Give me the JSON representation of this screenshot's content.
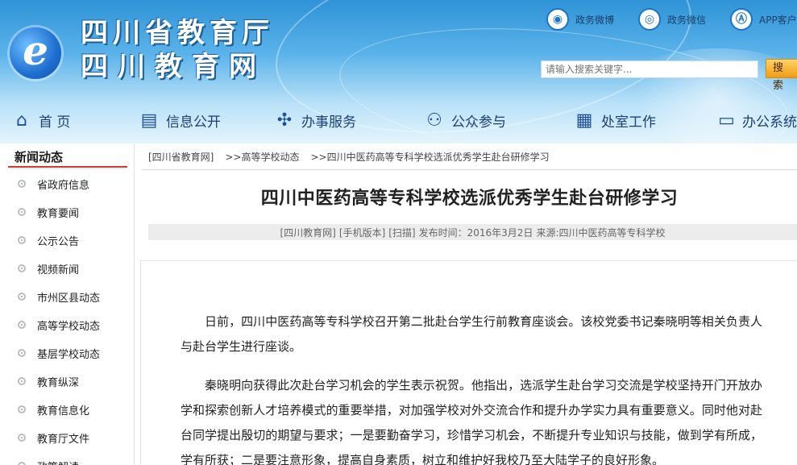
{
  "header": {
    "logo_letter": "e",
    "site_name_line1": "四川省教育厅",
    "site_name_line2": "四川教育网",
    "top_links": [
      {
        "icon": "weibo-icon",
        "glyph": "◉",
        "label": "政务微博"
      },
      {
        "icon": "wechat-icon",
        "glyph": "◎",
        "label": "政务微信"
      },
      {
        "icon": "app-icon",
        "glyph": "Ⓐ",
        "label": "APP客户"
      }
    ],
    "search": {
      "placeholder": "请输入搜索关键字...",
      "button_label": "搜 索"
    }
  },
  "nav": {
    "items": [
      {
        "icon": "home-icon",
        "glyph": "⌂",
        "label": "首 页"
      },
      {
        "icon": "document-icon",
        "glyph": "▤",
        "label": "信息公开"
      },
      {
        "icon": "service-icon",
        "glyph": "✣",
        "label": "办事服务"
      },
      {
        "icon": "user-icon",
        "glyph": "⚇",
        "label": "公众参与"
      },
      {
        "icon": "calendar-icon",
        "glyph": "▦",
        "label": "处室工作"
      },
      {
        "icon": "monitor-icon",
        "glyph": "▭",
        "label": "办公系统"
      }
    ]
  },
  "sidebar": {
    "title": "新闻动态",
    "items": [
      {
        "label": "省政府信息"
      },
      {
        "label": "教育要闻"
      },
      {
        "label": "公示公告"
      },
      {
        "label": "视频新闻"
      },
      {
        "label": "市州区县动态"
      },
      {
        "label": "高等学校动态"
      },
      {
        "label": "基层学校动态"
      },
      {
        "label": "教育纵深"
      },
      {
        "label": "教育信息化"
      },
      {
        "label": "教育厅文件"
      },
      {
        "label": "政策解读"
      }
    ]
  },
  "breadcrumb": {
    "items": [
      "[四川省教育网]",
      ">>高等学校动态",
      ">>四川中医药高等专科学校选派优秀学生赴台研修学习"
    ]
  },
  "article": {
    "title": "四川中医药高等专科学校选派优秀学生赴台研修学习",
    "meta": {
      "site": "[四川教育网]",
      "mobile": "[手机版本]",
      "scan": "[扫描]",
      "date": "发布时间：2016年3月2日",
      "source": "来源:四川中医药高等专科学校"
    },
    "paragraphs": [
      "日前，四川中医药高等专科学校召开第二批赴台学生行前教育座谈会。该校党委书记秦晓明等相关负责人与赴台学生进行座谈。",
      "秦晓明向获得此次赴台学习机会的学生表示祝贺。他指出，选派学生赴台学习交流是学校坚持开门开放办学和探索创新人才培养模式的重要举措，对加强学校对外交流合作和提升办学实力具有重要意义。同时他对赴台同学提出殷切的期望与要求；一是要勤奋学习，珍惜学习机会，不断提升专业知识与技能，做到学有所成，学有所获；二是要注意形象，提高自身素质，树立和维护好我校乃至大陆学子的良好形象。"
    ]
  }
}
